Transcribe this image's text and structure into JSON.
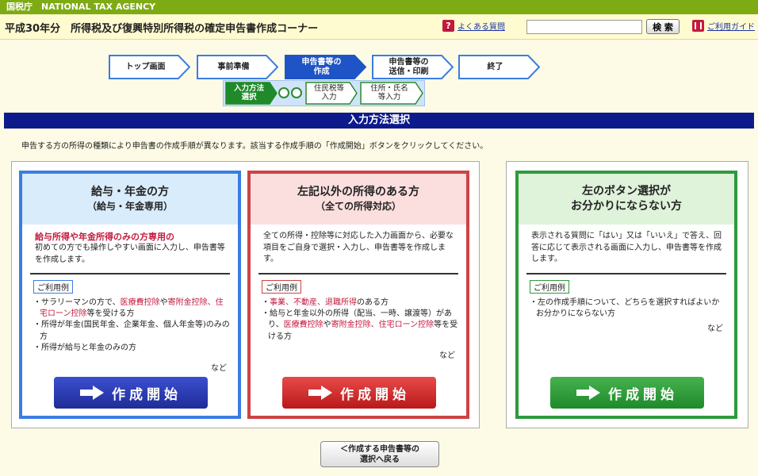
{
  "agency": "国税庁　NATIONAL TAX AGENCY",
  "header": {
    "title": "平成30年分　所得税及び復興特別所得税の確定申告書作成コーナー",
    "faq_link": "よくある質問",
    "search_button": "検 索",
    "guide_link": "ご利用ガイド",
    "icons": [
      "question-icon",
      "book-icon"
    ]
  },
  "progress_steps": [
    {
      "label": "トップ画面",
      "state": "normal"
    },
    {
      "label": "事前準備",
      "state": "normal"
    },
    {
      "label": "申告書等の\n作成",
      "state": "active"
    },
    {
      "label": "申告書等の\n送信・印刷",
      "state": "normal"
    },
    {
      "label": "終了",
      "state": "normal"
    }
  ],
  "sub_steps": [
    {
      "label": "入力方法\n選択",
      "state": "active"
    },
    {
      "label": "住民税等\n入力",
      "state": "normal"
    },
    {
      "label": "住所・氏名\n等入力",
      "state": "normal"
    }
  ],
  "section_title": "入力方法選択",
  "intro": "申告する方の所得の種類により申告書の作成手順が異なります。該当する作成手順の「作成開始」ボタンをクリックしてください。",
  "cards": [
    {
      "title": "給与・年金の方",
      "subtitle": "（給与・年金専用）",
      "lead": "給与所得や年金所得のみの方専用の",
      "desc": "初めての方でも操作しやすい画面に入力し、申告書等を作成します。",
      "example_label": "ご利用例",
      "examples": [
        {
          "pre": "サラリーマンの方で、",
          "hl": "医療費控除",
          "mid": "や",
          "hl2": "寄附金控除、住宅ローン控除",
          "post": "等を受ける方"
        },
        {
          "pre": "所得が年金(国民年金、企業年金、個人年金等)のみの方",
          "hl": "",
          "mid": "",
          "hl2": "",
          "post": ""
        },
        {
          "pre": "所得が給与と年金のみの方",
          "hl": "",
          "mid": "",
          "hl2": "",
          "post": ""
        }
      ],
      "etc": "など",
      "button": "作成開始",
      "color": "#3a7de2"
    },
    {
      "title": "左記以外の所得のある方",
      "subtitle": "（全ての所得対応）",
      "desc": "全ての所得・控除等に対応した入力画面から、必要な項目をご自身で選択・入力し、申告書等を作成します。",
      "example_label": "ご利用例",
      "examples": [
        {
          "pre": "",
          "hl": "事業、不動産、退職所得",
          "mid": "",
          "hl2": "",
          "post": "のある方"
        },
        {
          "pre": "給与と年金以外の所得（配当、一時、譲渡等）があり、",
          "hl": "医療費控除",
          "mid": "や",
          "hl2": "寄附金控除、住宅ローン控除",
          "post": "等を受ける方"
        }
      ],
      "etc": "など",
      "button": "作成開始",
      "color": "#cc4444"
    },
    {
      "title": "左のボタン選択が",
      "subtitle": "お分かりにならない方",
      "desc": "表示される質問に「はい」又は「いいえ」で答え、回答に応じて表示される画面に入力し、申告書等を作成します。",
      "example_label": "ご利用例",
      "examples": [
        {
          "pre": "左の作成手順について、どちらを選択すればよいかお分かりにならない方",
          "hl": "",
          "mid": "",
          "hl2": "",
          "post": ""
        }
      ],
      "etc": "など",
      "button": "作成開始",
      "color": "#2e9a3c"
    }
  ],
  "back_button": "＜作成する申告書等の\n選択へ戻る"
}
